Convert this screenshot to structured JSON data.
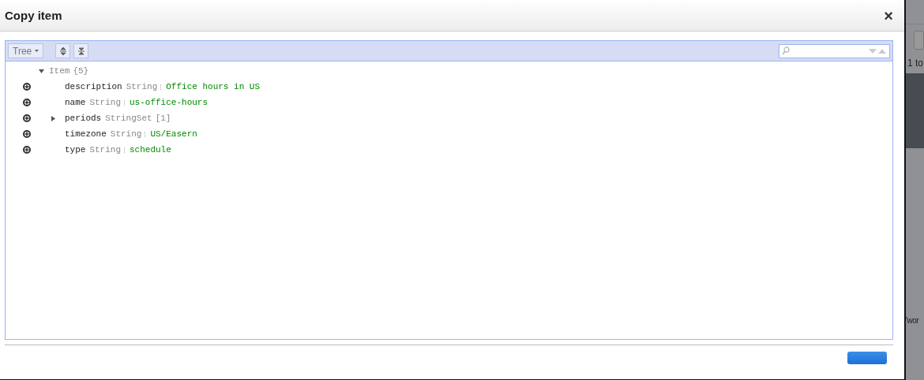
{
  "dialog": {
    "title": "Copy item",
    "close": "×"
  },
  "toolbar": {
    "view_button": "Tree"
  },
  "tree": {
    "label": "Item",
    "count": "{5}",
    "expanded": true,
    "children": [
      {
        "key": "description",
        "type": "String",
        "value": "Office hours in US"
      },
      {
        "key": "name",
        "type": "String",
        "value": "us-office-hours"
      },
      {
        "key": "periods",
        "type": "StringSet",
        "count": "[1]",
        "expanded": false
      },
      {
        "key": "timezone",
        "type": "String",
        "value": "US/Easern"
      },
      {
        "key": "type",
        "type": "String",
        "value": "schedule"
      }
    ]
  },
  "background": {
    "texts": [
      "1 to",
      "'wor"
    ]
  }
}
